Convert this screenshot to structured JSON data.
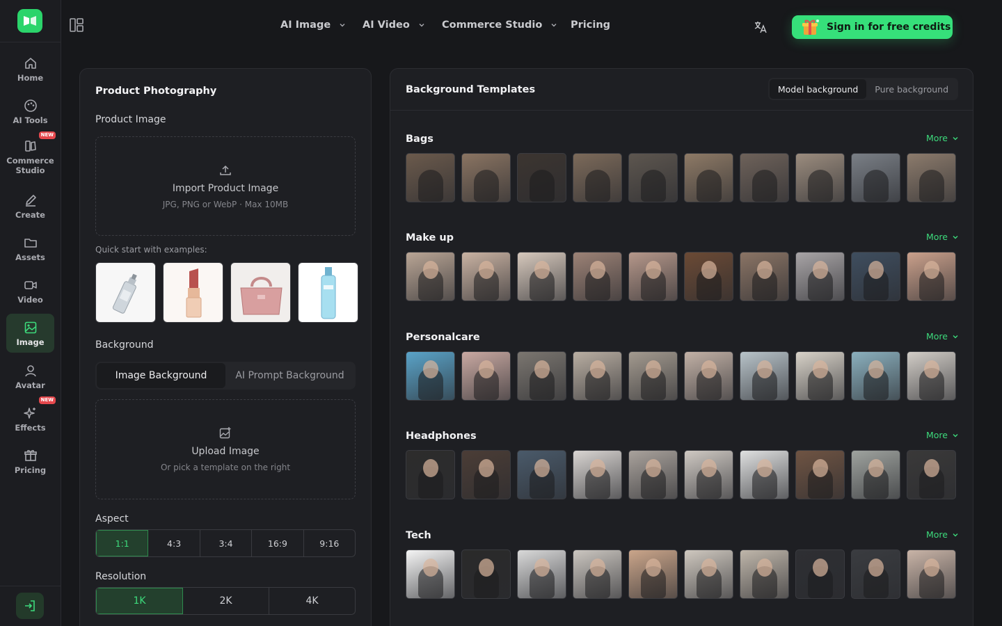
{
  "nav": {
    "items": [
      {
        "label": "Home",
        "icon": "home-icon"
      },
      {
        "label": "AI Tools",
        "icon": "palette-icon"
      },
      {
        "label": "Commerce Studio",
        "icon": "commerce-icon",
        "badge": "NEW"
      },
      {
        "label": "Create",
        "icon": "pen-icon"
      },
      {
        "label": "Assets",
        "icon": "folder-icon"
      },
      {
        "label": "Video",
        "icon": "video-icon"
      },
      {
        "label": "Image",
        "icon": "image-icon",
        "active": true
      },
      {
        "label": "Avatar",
        "icon": "user-icon"
      },
      {
        "label": "Effects",
        "icon": "sparkles-icon",
        "badge": "NEW"
      },
      {
        "label": "Pricing",
        "icon": "gift-icon"
      }
    ]
  },
  "topnav": {
    "ai_image": "AI Image",
    "ai_video": "AI Video",
    "commerce_studio": "Commerce Studio",
    "pricing": "Pricing",
    "signin": "Sign in for free credits"
  },
  "left": {
    "title": "Product Photography",
    "product_image_label": "Product Image",
    "import_main": "Import Product Image",
    "import_sub": "JPG, PNG or WebP · Max 10MB",
    "quick_start": "Quick start with examples:",
    "examples": [
      "spray-bottle",
      "lipstick",
      "handbag",
      "serum-bottle"
    ],
    "background_label": "Background",
    "bg_tabs": {
      "image": "Image Background",
      "prompt": "AI Prompt Background"
    },
    "upload_main": "Upload Image",
    "upload_sub": "Or pick a template on the right",
    "aspect_label": "Aspect",
    "aspects": [
      "1:1",
      "4:3",
      "3:4",
      "16:9",
      "9:16"
    ],
    "aspect_selected": "1:1",
    "resolution_label": "Resolution",
    "resolutions": [
      "1K",
      "2K",
      "4K"
    ],
    "resolution_selected": "1K"
  },
  "right": {
    "title": "Background Templates",
    "tabs": {
      "model": "Model background",
      "pure": "Pure background"
    },
    "more_label": "More",
    "categories": [
      "Bags",
      "Make up",
      "Personalcare",
      "Headphones",
      "Tech"
    ]
  },
  "colors": {
    "accent": "#36e07a",
    "accent_text": "#3ddb7c",
    "bg": "#17181b",
    "panel": "#1e1f23"
  }
}
